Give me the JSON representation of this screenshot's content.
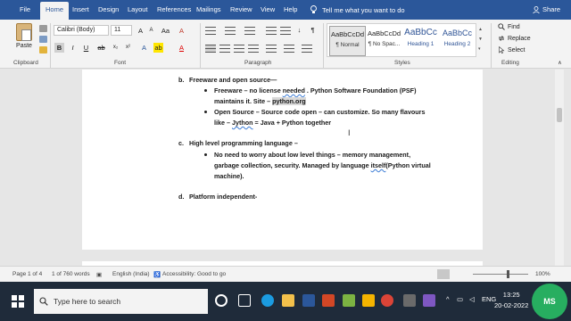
{
  "tabs": [
    "File",
    "Home",
    "Insert",
    "Design",
    "Layout",
    "References",
    "Mailings",
    "Review",
    "View",
    "Help"
  ],
  "tell_me": "Tell me what you want to do",
  "share": "Share",
  "ribbon": {
    "clipboard": {
      "paste": "Paste",
      "label": "Clipboard"
    },
    "font": {
      "name": "Calibri (Body)",
      "size": "11",
      "label": "Font",
      "bold": "B",
      "italic": "I",
      "underline": "U"
    },
    "paragraph": {
      "label": "Paragraph"
    },
    "styles": {
      "label": "Styles",
      "items": [
        {
          "sample": "AaBbCcDd",
          "name": "¶ Normal"
        },
        {
          "sample": "AaBbCcDd",
          "name": "¶ No Spac..."
        },
        {
          "sample": "AaBbCc",
          "name": "Heading 1"
        },
        {
          "sample": "AaBbCc",
          "name": "Heading 2"
        }
      ]
    },
    "editing": {
      "label": "Editing",
      "find": "Find",
      "replace": "Replace",
      "select": "Select"
    }
  },
  "document": {
    "b_marker": "b.",
    "b_heading": "Freeware and open source—",
    "b_bullet1_line1_pre": "Freeware – no license ",
    "b_bullet1_line1_squig": "needed",
    "b_bullet1_line1_post": " . Python Software Foundation (PSF)",
    "b_bullet1_line2_pre": "maintains it. Site – ",
    "b_bullet1_line2_hl": "python.org",
    "b_bullet2_line1": "Open Source – Source code open – can customize. So many flavours",
    "b_bullet2_line2_pre": "like – ",
    "b_bullet2_line2_squig": "Jython",
    "b_bullet2_line2_post": " = Java + Python together",
    "c_marker": "c.",
    "c_heading": "High level programming language –",
    "c_bullet1_line1": "No need to worry about low level things – memory management,",
    "c_bullet1_line2_pre": "garbage collection, security. Managed by language ",
    "c_bullet1_line2_squig": "itself",
    "c_bullet1_line2_post": "(Python virtual",
    "c_bullet1_line3": "machine).",
    "d_marker": "d.",
    "d_heading": "Platform independent-"
  },
  "status": {
    "page": "Page 1 of 4",
    "words": "1 of 760 words",
    "language": "English (India)",
    "accessibility": "Accessibility: Good to go",
    "zoom": "100%"
  },
  "taskbar": {
    "search_placeholder": "Type here to search",
    "tray_lang": "ENG",
    "time": "13:25",
    "date": "20-02-2022",
    "avatar": "MS"
  }
}
